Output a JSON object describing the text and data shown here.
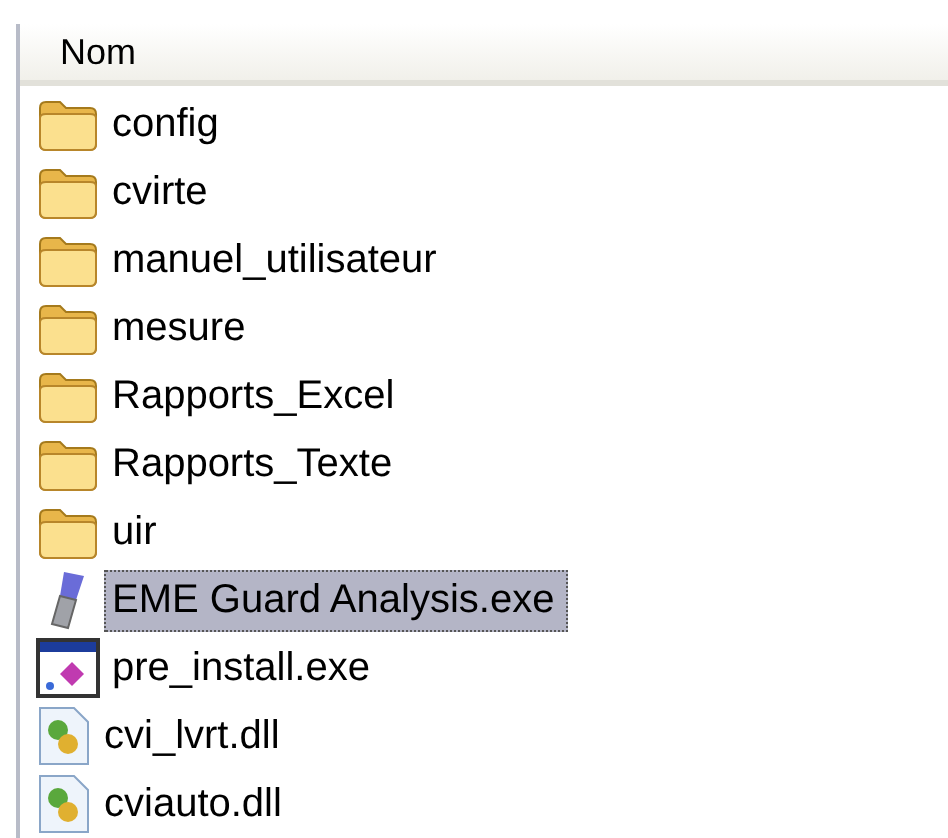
{
  "table": {
    "columns": [
      "Nom"
    ],
    "rows": [
      {
        "name": "config",
        "kind": "folder",
        "selected": false
      },
      {
        "name": "cvirte",
        "kind": "folder",
        "selected": false
      },
      {
        "name": "manuel_utilisateur",
        "kind": "folder",
        "selected": false
      },
      {
        "name": "mesure",
        "kind": "folder",
        "selected": false
      },
      {
        "name": "Rapports_Excel",
        "kind": "folder",
        "selected": false
      },
      {
        "name": "Rapports_Texte",
        "kind": "folder",
        "selected": false
      },
      {
        "name": "uir",
        "kind": "folder",
        "selected": false
      },
      {
        "name": "EME Guard Analysis.exe",
        "kind": "app",
        "selected": true
      },
      {
        "name": "pre_install.exe",
        "kind": "installer",
        "selected": false
      },
      {
        "name": "cvi_lvrt.dll",
        "kind": "dll",
        "selected": false
      },
      {
        "name": "cviauto.dll",
        "kind": "dll",
        "selected": false
      }
    ]
  }
}
